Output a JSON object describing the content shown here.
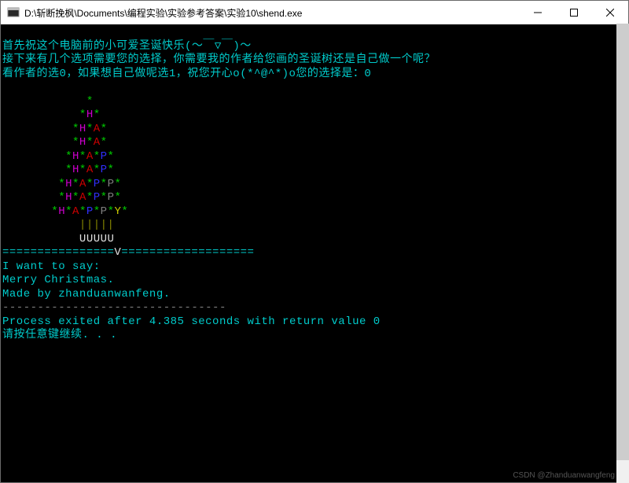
{
  "window": {
    "title": "D:\\斩断挽枫\\Documents\\编程实验\\实验参考答案\\实验10\\shend.exe"
  },
  "lines": {
    "l1": "首先祝这个电脑前的小可爱圣诞快乐(～￣▽￣)～",
    "l2": "接下来有几个选项需要您的选择，你需要我的作者给您画的圣诞树还是自己做一个呢？",
    "l3a": "看作者的选0，如果想自己做呢选1，祝您开心o(*^@^*)o您的选择是：",
    "l3b": "0"
  },
  "tree": {
    "row1": "            *",
    "row2a": "           *",
    "row2H": "H",
    "row2b": "*",
    "row3a": "          *",
    "row3H": "H",
    "row3s": "*",
    "row3A": "A",
    "row3b": "*",
    "row4a": "          *",
    "row4H": "H",
    "row4s": "*",
    "row4A": "A",
    "row4b": "*",
    "row5a": "         *",
    "row5H": "H",
    "row5s1": "*",
    "row5A": "A",
    "row5s2": "*",
    "row5P": "P",
    "row5b": "*",
    "row6a": "         *",
    "row6H": "H",
    "row6s1": "*",
    "row6A": "A",
    "row6s2": "*",
    "row6P": "P",
    "row6b": "*",
    "row7a": "        *",
    "row7H": "H",
    "row7s1": "*",
    "row7A": "A",
    "row7s2": "*",
    "row7P": "P",
    "row7s3": "*",
    "row7P2": "P",
    "row7b": "*",
    "row8a": "        *",
    "row8H": "H",
    "row8s1": "*",
    "row8A": "A",
    "row8s2": "*",
    "row8P": "P",
    "row8s3": "*",
    "row8P2": "P",
    "row8b": "*",
    "row9a": "       *",
    "row9H": "H",
    "row9s1": "*",
    "row9A": "A",
    "row9s2": "*",
    "row9P": "P",
    "row9s3": "*",
    "row9P2": "P",
    "row9s4": "*",
    "row9Y": "Y",
    "row9b": "*",
    "trunk_pipes": "           |||||",
    "trunk_u": "           UUUUU",
    "ground_a": "================",
    "ground_v": "V",
    "ground_b": "==================="
  },
  "msg": {
    "say": "I want to say:",
    "merry": "Merry Christmas.",
    "made": "Made by zhanduanwanfeng.",
    "dash": "--------------------------------"
  },
  "exit": {
    "proc": "Process exited after 4.385 seconds with return value 0",
    "press": "请按任意键继续. . ."
  },
  "watermark": "CSDN @Zhanduanwangfeng"
}
